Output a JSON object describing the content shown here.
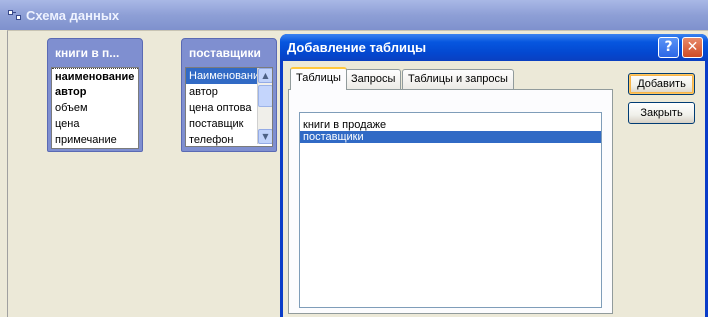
{
  "parent_window": {
    "title": "Схема данных",
    "icon": "relationships-icon"
  },
  "tables": [
    {
      "title": "книги в п...",
      "fields": [
        {
          "label": "наименование",
          "key": true
        },
        {
          "label": "автор",
          "key": true
        },
        {
          "label": "объем",
          "key": false
        },
        {
          "label": "цена",
          "key": false
        },
        {
          "label": "примечание",
          "key": false
        }
      ]
    },
    {
      "title": "поставщики",
      "fields": [
        {
          "label": "Наименовани",
          "selected": true
        },
        {
          "label": "автор"
        },
        {
          "label": "цена оптова"
        },
        {
          "label": "поставщик"
        },
        {
          "label": "телефон"
        }
      ],
      "scrollbar": {
        "up": "▲",
        "down": "▼"
      }
    }
  ],
  "dialog": {
    "title": "Добавление таблицы",
    "help_label": "?",
    "close_label": "✕",
    "tabs": [
      "Таблицы",
      "Запросы",
      "Таблицы и запросы"
    ],
    "active_tab": 0,
    "list_items": [
      "книги в продаже",
      "поставщики"
    ],
    "selected_item": 1,
    "add_button": "Добавить",
    "close_button": "Закрыть"
  },
  "colors": {
    "selection": "#316ac5",
    "dialog_title": "#0448d0",
    "table_header": "#7f8fd0"
  }
}
